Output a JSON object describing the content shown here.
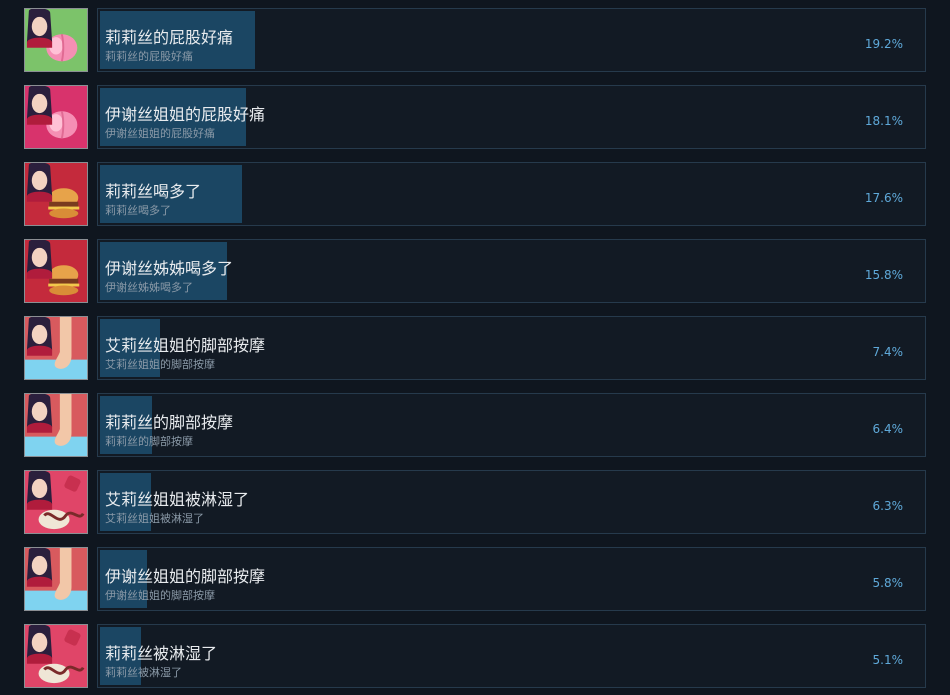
{
  "achievements": [
    {
      "title": "莉莉丝的屁股好痛",
      "subtitle": "莉莉丝的屁股好痛",
      "percent_label": "19.2%",
      "percent": 19.2,
      "icon": "peach-icon",
      "bg": "#7cc36a"
    },
    {
      "title": "伊谢丝姐姐的屁股好痛",
      "subtitle": "伊谢丝姐姐的屁股好痛",
      "percent_label": "18.1%",
      "percent": 18.1,
      "icon": "peach-icon",
      "bg": "#d8336c"
    },
    {
      "title": "莉莉丝喝多了",
      "subtitle": "莉莉丝喝多了",
      "percent_label": "17.6%",
      "percent": 17.6,
      "icon": "burger-icon",
      "bg": "#c42a3c"
    },
    {
      "title": "伊谢丝姊姊喝多了",
      "subtitle": "伊谢丝姊姊喝多了",
      "percent_label": "15.8%",
      "percent": 15.8,
      "icon": "burger-icon",
      "bg": "#c42a3c"
    },
    {
      "title": "艾莉丝姐姐的脚部按摩",
      "subtitle": "艾莉丝姐姐的脚部按摩",
      "percent_label": "7.4%",
      "percent": 7.4,
      "icon": "foot-icon",
      "bg": "#d85a5e"
    },
    {
      "title": "莉莉丝的脚部按摩",
      "subtitle": "莉莉丝的脚部按摩",
      "percent_label": "6.4%",
      "percent": 6.4,
      "icon": "foot-icon",
      "bg": "#d85a5e"
    },
    {
      "title": "艾莉丝姐姐被淋湿了",
      "subtitle": "艾莉丝姐姐被淋湿了",
      "percent_label": "6.3%",
      "percent": 6.3,
      "icon": "tentacle-icon",
      "bg": "#e04568"
    },
    {
      "title": "伊谢丝姐姐的脚部按摩",
      "subtitle": "伊谢丝姐姐的脚部按摩",
      "percent_label": "5.8%",
      "percent": 5.8,
      "icon": "foot-icon",
      "bg": "#d85a5e"
    },
    {
      "title": "莉莉丝被淋湿了",
      "subtitle": "莉莉丝被淋湿了",
      "percent_label": "5.1%",
      "percent": 5.1,
      "icon": "tentacle-icon",
      "bg": "#e04568"
    }
  ]
}
